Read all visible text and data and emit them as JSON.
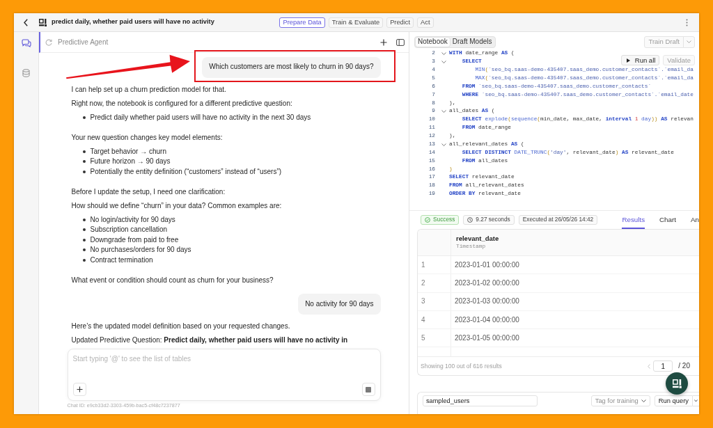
{
  "window": {
    "title": "predict daily, whether paid users will have no activity",
    "stages": [
      {
        "label": "Prepare Data",
        "selected": true
      },
      {
        "label": "Train & Evaluate",
        "selected": false
      },
      {
        "label": "Predict",
        "selected": false
      },
      {
        "label": "Act",
        "selected": false
      }
    ]
  },
  "rail": [
    {
      "kind": "chat",
      "selected": true
    },
    {
      "kind": "database",
      "selected": false
    }
  ],
  "agent_panel": {
    "title": "Predictive Agent",
    "messages": [
      {
        "kind": "user",
        "text": "Which customers are most likely to churn in 90 days?",
        "highlighted": true
      },
      {
        "kind": "agent",
        "blocks": [
          {
            "kind": "paragraph",
            "text": "I can help set up a churn prediction model for that."
          },
          {
            "kind": "paragraph",
            "text": "Right now, the notebook is configured for a different predictive question:"
          },
          {
            "kind": "bullets",
            "items": [
              "Predict daily whether paid users will have no activity in the next 30 days"
            ]
          },
          {
            "kind": "paragraph",
            "text": "Your new question changes key model elements:"
          },
          {
            "kind": "bullets",
            "items": [
              "Target behavior → churn",
              "Future horizon → 90 days",
              "Potentially the entity definition (“customers” instead of “users”)"
            ]
          },
          {
            "kind": "paragraph",
            "text": "Before I update the setup, I need one clarification:"
          },
          {
            "kind": "paragraph",
            "text": "How should we define “churn” in your data? Common examples are:"
          },
          {
            "kind": "bullets",
            "items": [
              "No login/activity for 90 days",
              "Subscription cancellation",
              "Downgrade from paid to free",
              "No purchases/orders for 90 days",
              "Contract termination"
            ]
          },
          {
            "kind": "paragraph",
            "text": "What event or condition should count as churn for your business?"
          }
        ]
      },
      {
        "kind": "user",
        "text": "No activity for 90 days",
        "highlighted": false
      },
      {
        "kind": "agent",
        "blocks": [
          {
            "kind": "paragraph",
            "text": "Here’s the updated model definition based on your requested changes."
          },
          {
            "kind": "paragraph",
            "text": "Updated Predictive Question: **Predict daily, whether paid users will have no activity in**"
          }
        ]
      }
    ],
    "composer": {
      "placeholder": "Start typing '@' to see the list of tables"
    },
    "chat_id": "Chat ID: e9cb33d2-3303-459b-bac5-cf48c7237877"
  },
  "notebook": {
    "views": [
      {
        "label": "Notebook",
        "selected": true
      },
      {
        "label": "Draft Models",
        "selected": false
      }
    ],
    "train_button": {
      "label": "Train Draft",
      "disabled": true
    },
    "editor": {
      "actions": [
        {
          "kind": "run",
          "label": "Run all",
          "disabled": false
        },
        {
          "kind": "validate",
          "label": "Validate",
          "disabled": true
        }
      ],
      "lines": [
        {
          "number": "2",
          "foldable": true,
          "tokens": [
            {
              "kind": "keyword",
              "text": "WITH"
            },
            {
              "kind": "plain",
              "text": " date_range "
            },
            {
              "kind": "keyword",
              "text": "AS"
            },
            {
              "kind": "plain",
              "text": " ("
            }
          ]
        },
        {
          "number": "3",
          "foldable": true,
          "tokens": [
            {
              "kind": "keyword",
              "text": "    SELECT"
            }
          ]
        },
        {
          "number": "4",
          "foldable": false,
          "tokens": [
            {
              "kind": "function",
              "text": "        MIN"
            },
            {
              "kind": "paren",
              "text": "("
            },
            {
              "kind": "string",
              "text": "`seo_bq.saas-demo-435407.saas_demo.customer_contacts`.`email_da"
            }
          ]
        },
        {
          "number": "5",
          "foldable": false,
          "tokens": [
            {
              "kind": "function",
              "text": "        MAX"
            },
            {
              "kind": "paren",
              "text": "("
            },
            {
              "kind": "string",
              "text": "`seo_bq.saas-demo-435407.saas_demo.customer_contacts`.`email_da"
            }
          ]
        },
        {
          "number": "6",
          "foldable": false,
          "tokens": [
            {
              "kind": "keyword",
              "text": "    FROM"
            },
            {
              "kind": "string",
              "text": " `seo_bq.saas-demo-435407.saas_demo.customer_contacts`"
            }
          ]
        },
        {
          "number": "7",
          "foldable": false,
          "tokens": [
            {
              "kind": "keyword",
              "text": "    WHERE"
            },
            {
              "kind": "string",
              "text": " `seo_bq.saas-demo-435407.saas_demo.customer_contacts`.`email_date"
            }
          ]
        },
        {
          "number": "8",
          "foldable": false,
          "tokens": [
            {
              "kind": "plain",
              "text": "),"
            }
          ]
        },
        {
          "number": "9",
          "foldable": true,
          "tokens": [
            {
              "kind": "plain",
              "text": "all_dates "
            },
            {
              "kind": "keyword",
              "text": "AS"
            },
            {
              "kind": "plain",
              "text": " ("
            }
          ]
        },
        {
          "number": "10",
          "foldable": false,
          "tokens": [
            {
              "kind": "keyword",
              "text": "    SELECT"
            },
            {
              "kind": "function",
              "text": " explode"
            },
            {
              "kind": "paren",
              "text": "("
            },
            {
              "kind": "function",
              "text": "sequence"
            },
            {
              "kind": "paren",
              "text": "("
            },
            {
              "kind": "plain",
              "text": "min_date, max_date, "
            },
            {
              "kind": "keyword",
              "text": "interval"
            },
            {
              "kind": "number",
              "text": " 1"
            },
            {
              "kind": "function",
              "text": " day"
            },
            {
              "kind": "paren",
              "text": "))"
            },
            {
              "kind": "keyword",
              "text": " AS"
            },
            {
              "kind": "plain",
              "text": " relevan"
            }
          ]
        },
        {
          "number": "11",
          "foldable": false,
          "tokens": [
            {
              "kind": "keyword",
              "text": "    FROM"
            },
            {
              "kind": "plain",
              "text": " date_range"
            }
          ]
        },
        {
          "number": "12",
          "foldable": false,
          "tokens": [
            {
              "kind": "plain",
              "text": "),"
            }
          ]
        },
        {
          "number": "13",
          "foldable": true,
          "tokens": [
            {
              "kind": "plain",
              "text": "all_relevant_dates "
            },
            {
              "kind": "keyword",
              "text": "AS"
            },
            {
              "kind": "plain",
              "text": " ("
            }
          ]
        },
        {
          "number": "14",
          "foldable": false,
          "tokens": [
            {
              "kind": "keyword",
              "text": "    SELECT DISTINCT"
            },
            {
              "kind": "function",
              "text": " DATE_TRUNC"
            },
            {
              "kind": "paren",
              "text": "("
            },
            {
              "kind": "string",
              "text": "'day'"
            },
            {
              "kind": "plain",
              "text": ", relevant_date"
            },
            {
              "kind": "paren",
              "text": ")"
            },
            {
              "kind": "keyword",
              "text": " AS"
            },
            {
              "kind": "plain",
              "text": " relevant_date"
            }
          ]
        },
        {
          "number": "15",
          "foldable": false,
          "tokens": [
            {
              "kind": "keyword",
              "text": "    FROM"
            },
            {
              "kind": "plain",
              "text": " all_dates"
            }
          ]
        },
        {
          "number": "16",
          "foldable": false,
          "tokens": [
            {
              "kind": "paren",
              "text": ")"
            }
          ]
        },
        {
          "number": "17",
          "foldable": false,
          "tokens": [
            {
              "kind": "keyword",
              "text": "SELECT"
            },
            {
              "kind": "plain",
              "text": " relevant_date"
            }
          ]
        },
        {
          "number": "18",
          "foldable": false,
          "tokens": [
            {
              "kind": "keyword",
              "text": "FROM"
            },
            {
              "kind": "plain",
              "text": " all_relevant_dates"
            }
          ]
        },
        {
          "number": "19",
          "foldable": false,
          "tokens": [
            {
              "kind": "keyword",
              "text": "ORDER BY"
            },
            {
              "kind": "plain",
              "text": " relevant_date"
            }
          ]
        }
      ]
    },
    "run_status": {
      "kind": "success",
      "label": "Success",
      "duration": "9.27 seconds",
      "executed": "Executed at 26/05/26 14:42"
    },
    "result_tabs": [
      {
        "label": "Results",
        "selected": true
      },
      {
        "label": "Chart",
        "selected": false
      },
      {
        "label": "An",
        "selected": false
      }
    ],
    "results": {
      "columns": [
        {
          "name": "relevant_date",
          "type": "Timestamp"
        }
      ],
      "rows": [
        {
          "number": "1",
          "cells": [
            "2023-01-01 00:00:00"
          ]
        },
        {
          "number": "2",
          "cells": [
            "2023-01-02 00:00:00"
          ]
        },
        {
          "number": "3",
          "cells": [
            "2023-01-03 00:00:00"
          ]
        },
        {
          "number": "4",
          "cells": [
            "2023-01-04 00:00:00"
          ]
        },
        {
          "number": "5",
          "cells": [
            "2023-01-05 00:00:00"
          ]
        }
      ],
      "summary": "Showing 100 out of 616 results",
      "previous_disabled": true,
      "page": "1",
      "page_total": "/ 20"
    },
    "next_cell": {
      "name": "sampled_users",
      "tag_menu": "Tag for training",
      "run_button": "Run query"
    }
  }
}
